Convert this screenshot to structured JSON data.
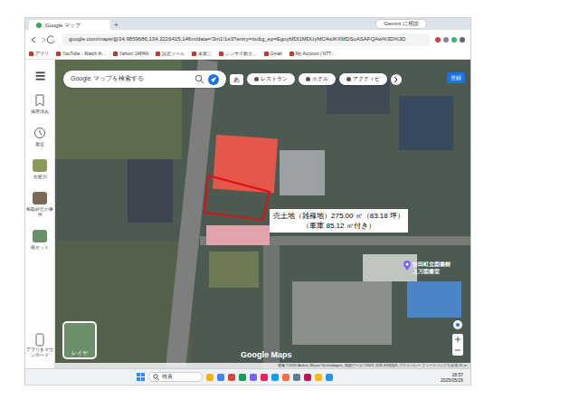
{
  "browser": {
    "tab_title": "Google マップ",
    "new_tab": "+",
    "gemini_button": "Gemini に相談",
    "url": "google.com/maps/@34.9859686,134.3226415,146m/data=!3m1!1e3?entry=ttu&g_ep=EgoyMDI1MDUyMC4wIKXMDSoASAFQAw%3D%3D"
  },
  "bookmarks": [
    "アプリ",
    "YouTube - Watch th...",
    "Yahoo! JAPAN",
    "設定ツール",
    "本業三",
    "シンサポ新台...",
    "Gmail",
    "My Account | NTT..."
  ],
  "sidebar": {
    "menu": "☰",
    "items": [
      {
        "label": "保存済み"
      },
      {
        "label": "最近"
      },
      {
        "label": "化粧川"
      },
      {
        "label": "鳥取砂丘の事件"
      },
      {
        "label": "祝セット"
      }
    ],
    "app_download": "アプリをダウンロード"
  },
  "search": {
    "placeholder": "Google マップを検索する"
  },
  "ime": "あ",
  "chips": [
    {
      "label": "レストラン"
    },
    {
      "label": "ホテル"
    },
    {
      "label": "アクティビ"
    }
  ],
  "account": "登録",
  "map": {
    "annotation": [
      "売土地（雑種地）275.00 ㎡（83.18 坪）",
      "（車庫 85.12 ㎡付き）"
    ],
    "place": {
      "name": "吉田町立図書館",
      "sub": "上万図書室"
    },
    "layer_button": "レイヤ",
    "watermark": "Google Maps",
    "attribution": "画像 ©2025 Airbus, Maxar Technologies, 地図データ ©2025 日本 利用規約 プライバシー フィードバックを送信 20 m"
  },
  "taskbar": {
    "search": "検索",
    "time": "18:57",
    "date": "2025/05/26"
  }
}
